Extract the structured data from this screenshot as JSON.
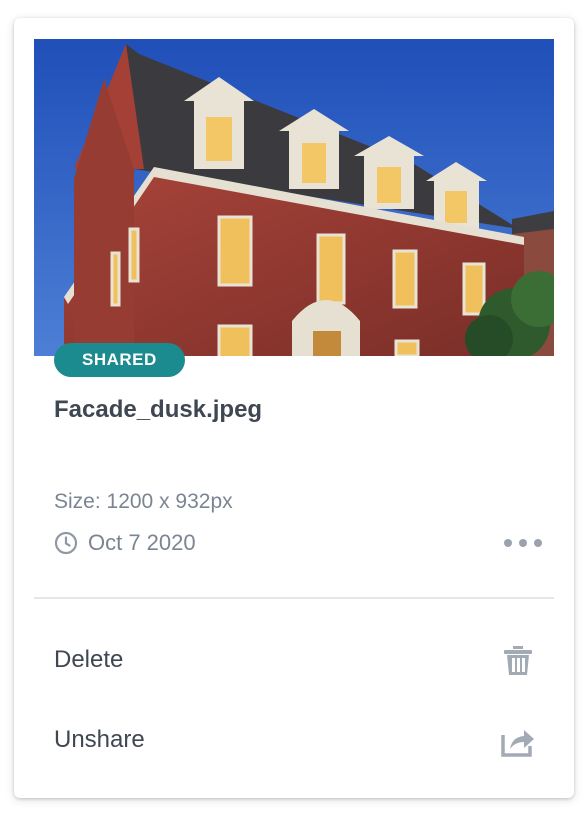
{
  "card": {
    "badge": "SHARED",
    "filename": "Facade_dusk.jpeg",
    "size_text": "Size: 1200 x 932px",
    "date": "Oct 7 2020",
    "clock_icon": "clock-icon",
    "more_icon": "more-horizontal-icon"
  },
  "actions": [
    {
      "label": "Delete",
      "icon": "trash-icon"
    },
    {
      "label": "Unshare",
      "icon": "share-icon"
    }
  ],
  "colors": {
    "badge_bg": "#1b8b8f",
    "text_dark": "#3f4752",
    "text_muted": "#7b8592",
    "icon_gray": "#9aa3ad"
  }
}
